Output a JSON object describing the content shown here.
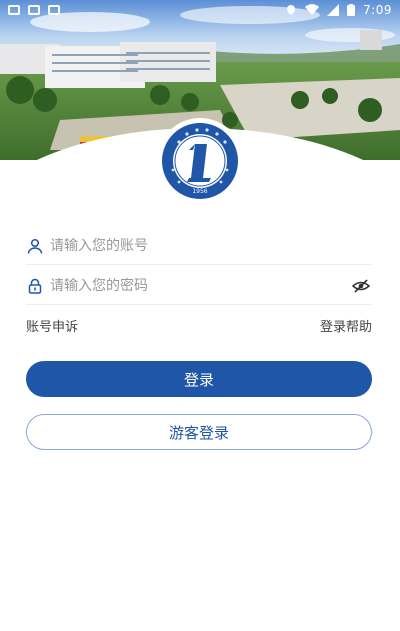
{
  "status_bar": {
    "time": "7:09"
  },
  "login_form": {
    "username_placeholder": "请输入您的账号",
    "password_placeholder": "请输入您的密码"
  },
  "links": {
    "appeal": "账号申诉",
    "help": "登录帮助"
  },
  "buttons": {
    "login": "登录",
    "guest_login": "游客登录"
  },
  "logo": {
    "year": "1956"
  },
  "colors": {
    "primary": "#1f56a8",
    "guest_border": "#8aa8d8",
    "placeholder": "#999999",
    "divider": "#eeeeee"
  },
  "icons": [
    "user-icon",
    "lock-icon",
    "eye-off-icon",
    "school-logo"
  ]
}
